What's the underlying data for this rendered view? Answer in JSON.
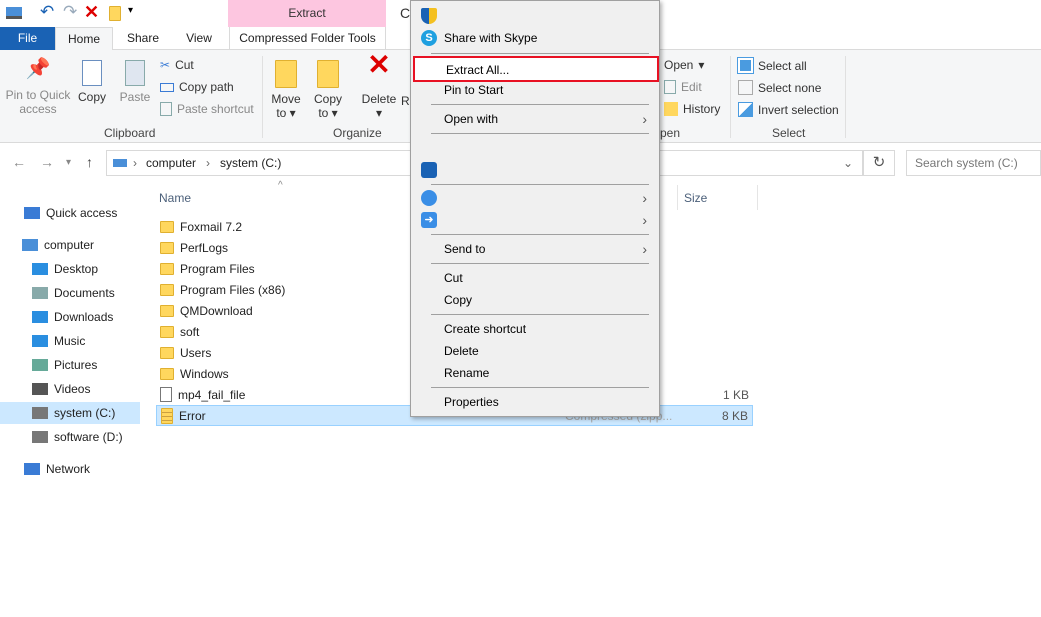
{
  "qat": {
    "title_partial": "C"
  },
  "ribbon_tabs": {
    "file": "File",
    "home": "Home",
    "share": "Share",
    "view": "View",
    "context_header": "Extract",
    "context_tab": "Compressed Folder Tools"
  },
  "clipboard": {
    "pin": "Pin to Quick access",
    "copy": "Copy",
    "paste": "Paste",
    "cut": "Cut",
    "copy_path": "Copy path",
    "paste_shortcut": "Paste shortcut",
    "group": "Clipboard"
  },
  "organize": {
    "move_to": "Move to",
    "copy_to": "Copy to",
    "delete": "Delete",
    "rename_partial": "R",
    "group": "Organize"
  },
  "open": {
    "open": "Open",
    "edit": "Edit",
    "history": "History",
    "group_partial": "pen"
  },
  "select": {
    "select_all": "Select all",
    "select_none": "Select none",
    "invert": "Invert selection",
    "group": "Select"
  },
  "address": {
    "crumbs": [
      "computer",
      "system (C:)"
    ],
    "search_placeholder": "Search system (C:)"
  },
  "columns": {
    "name": "Name",
    "size": "Size"
  },
  "sidebar": [
    {
      "label": "Quick access",
      "icon": "star-icon"
    },
    {
      "label": "computer",
      "icon": "computer-icon"
    },
    {
      "label": "Desktop",
      "icon": "desktop-icon"
    },
    {
      "label": "Documents",
      "icon": "documents-icon"
    },
    {
      "label": "Downloads",
      "icon": "downloads-icon"
    },
    {
      "label": "Music",
      "icon": "music-icon"
    },
    {
      "label": "Pictures",
      "icon": "pictures-icon"
    },
    {
      "label": "Videos",
      "icon": "videos-icon"
    },
    {
      "label": "system (C:)",
      "icon": "drive-icon",
      "selected": true
    },
    {
      "label": "software (D:)",
      "icon": "drive-icon"
    },
    {
      "label": "Network",
      "icon": "network-icon"
    }
  ],
  "files": [
    {
      "name": "Foxmail 7.2",
      "type": "folder",
      "size": ""
    },
    {
      "name": "PerfLogs",
      "type": "folder",
      "size": ""
    },
    {
      "name": "Program Files",
      "type": "folder",
      "size": ""
    },
    {
      "name": "Program Files (x86)",
      "type": "folder",
      "size": ""
    },
    {
      "name": "QMDownload",
      "type": "folder",
      "size": ""
    },
    {
      "name": "soft",
      "type": "folder",
      "size": ""
    },
    {
      "name": "Users",
      "type": "folder",
      "size": ""
    },
    {
      "name": "Windows",
      "type": "folder",
      "size": ""
    },
    {
      "name": "mp4_fail_file",
      "type": "file",
      "size": "1 KB"
    },
    {
      "name": "Error",
      "type": "zip",
      "size": "8 KB",
      "kind_partial": "Compressed (zipp...",
      "selected": true
    }
  ],
  "context_menu": {
    "share_skype": "Share with Skype",
    "extract_all": "Extract All...",
    "pin_start": "Pin to Start",
    "open_with": "Open with",
    "send_to": "Send to",
    "cut": "Cut",
    "copy": "Copy",
    "create_shortcut": "Create shortcut",
    "delete": "Delete",
    "rename": "Rename",
    "properties": "Properties",
    "highlight_color": "#e81123"
  }
}
